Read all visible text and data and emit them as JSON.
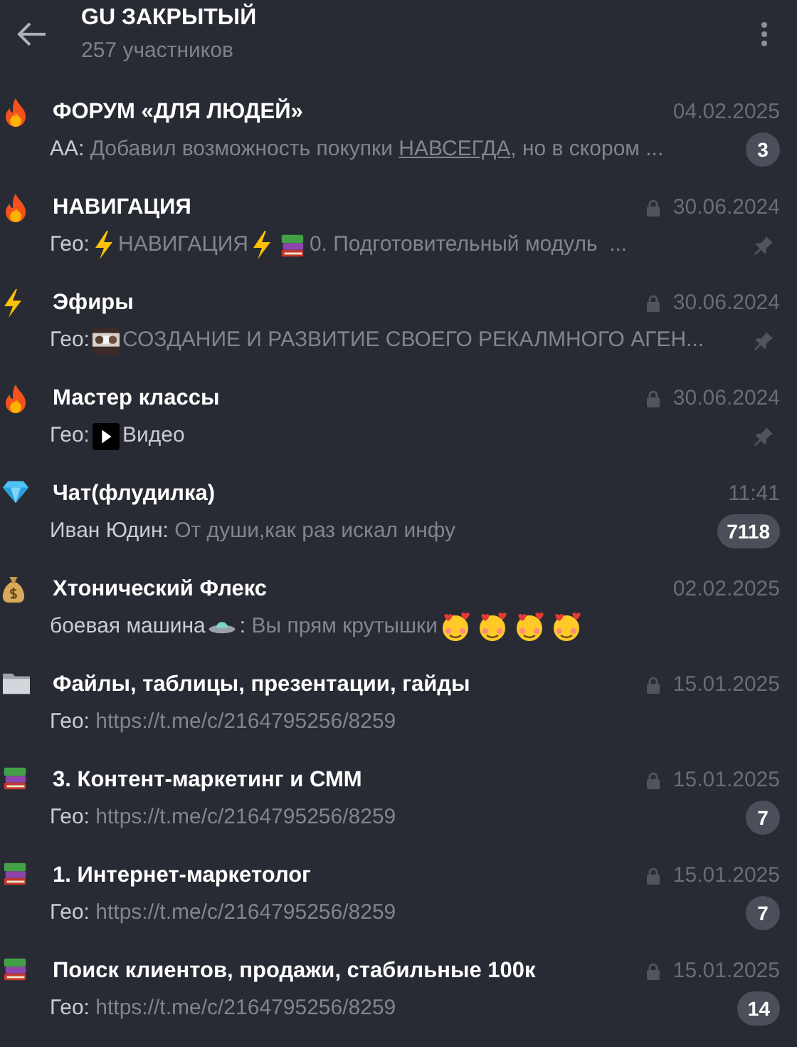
{
  "header": {
    "title": "GU ЗАКРЫТЫЙ",
    "subtitle": "257 участников"
  },
  "topics": [
    {
      "kind": "fire",
      "title": "ФОРУМ «ДЛЯ ЛЮДЕЙ»",
      "date": "04.02.2025",
      "locked": false,
      "pinned": false,
      "unread": "3",
      "preview": [
        {
          "kind": "sender",
          "text": "АА:"
        },
        {
          "kind": "text",
          "text": " Добавил возможность покупки "
        },
        {
          "kind": "underlined",
          "text": "НАВСЕГДА"
        },
        {
          "kind": "text",
          "text": ", но в скором ..."
        }
      ]
    },
    {
      "kind": "fire",
      "title": "НАВИГАЦИЯ",
      "date": "30.06.2024",
      "locked": true,
      "pinned": true,
      "preview": [
        {
          "kind": "sender",
          "text": "Гео:"
        },
        {
          "kind": "lightning"
        },
        {
          "kind": "text",
          "text": "НАВИГАЦИЯ"
        },
        {
          "kind": "lightning"
        },
        {
          "kind": "books"
        },
        {
          "kind": "text",
          "text": "0. Подготовительный модуль  ..."
        }
      ]
    },
    {
      "kind": "lightning",
      "title": "Эфиры",
      "date": "30.06.2024",
      "locked": true,
      "pinned": true,
      "preview": [
        {
          "kind": "sender",
          "text": "Гео:"
        },
        {
          "kind": "thumbnail"
        },
        {
          "kind": "text",
          "text": "СОЗДАНИЕ И РАЗВИТИЕ СВОЕГО РЕКАЛМНОГО АГЕН..."
        }
      ]
    },
    {
      "kind": "fire",
      "title": "Мастер классы",
      "date": "30.06.2024",
      "locked": true,
      "pinned": true,
      "preview": [
        {
          "kind": "sender",
          "text": "Гео:"
        },
        {
          "kind": "play"
        },
        {
          "kind": "media",
          "text": "Видео"
        }
      ]
    },
    {
      "kind": "diamond",
      "title": "Чат(флудилка)",
      "date": "11:41",
      "locked": false,
      "pinned": false,
      "unread": "7118",
      "preview": [
        {
          "kind": "sender",
          "text": "Иван Юдин:"
        },
        {
          "kind": "text",
          "text": " От души,как раз искал инфу"
        }
      ]
    },
    {
      "kind": "moneybag",
      "title": "Хтонический Флекс",
      "date": "02.02.2025",
      "locked": false,
      "pinned": false,
      "preview": [
        {
          "kind": "sender",
          "text": "боевая машина"
        },
        {
          "kind": "ufo"
        },
        {
          "kind": "sender",
          "text": ":"
        },
        {
          "kind": "text",
          "text": " Вы прям крутышки"
        },
        {
          "kind": "smiley"
        },
        {
          "kind": "smiley"
        },
        {
          "kind": "smiley"
        },
        {
          "kind": "smiley"
        }
      ]
    },
    {
      "kind": "folder",
      "title": "Файлы, таблицы, презентации, гайды",
      "date": "15.01.2025",
      "locked": true,
      "pinned": false,
      "preview": [
        {
          "kind": "sender",
          "text": "Гео:"
        },
        {
          "kind": "text",
          "text": " https://t.me/c/2164795256/8259"
        }
      ]
    },
    {
      "kind": "books",
      "title": "3. Контент-маркетинг и СММ",
      "date": "15.01.2025",
      "locked": true,
      "pinned": false,
      "unread": "7",
      "preview": [
        {
          "kind": "sender",
          "text": "Гео:"
        },
        {
          "kind": "text",
          "text": " https://t.me/c/2164795256/8259"
        }
      ]
    },
    {
      "kind": "books",
      "title": "1. Интернет-маркетолог",
      "date": "15.01.2025",
      "locked": true,
      "pinned": false,
      "unread": "7",
      "preview": [
        {
          "kind": "sender",
          "text": "Гео:"
        },
        {
          "kind": "text",
          "text": " https://t.me/c/2164795256/8259"
        }
      ]
    },
    {
      "kind": "books",
      "title": "Поиск клиентов, продажи, стабильные 100к",
      "date": "15.01.2025",
      "locked": true,
      "pinned": false,
      "unread": "14",
      "preview": [
        {
          "kind": "sender",
          "text": "Гео:"
        },
        {
          "kind": "text",
          "text": " https://t.me/c/2164795256/8259"
        }
      ]
    }
  ]
}
